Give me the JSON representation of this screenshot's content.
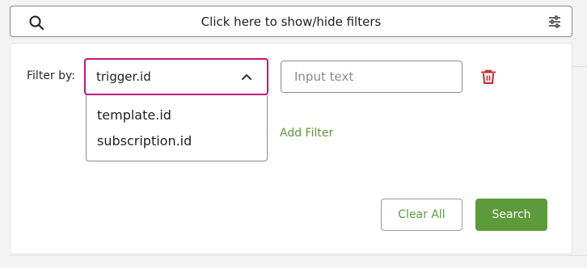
{
  "filter_toggle": {
    "label": "Click here to show/hide filters",
    "left_icon": "search-icon",
    "right_icon": "sliders-icon"
  },
  "filter_row": {
    "label": "Filter by:",
    "field_selected": "trigger.id",
    "field_options": [
      "template.id",
      "subscription.id"
    ],
    "value_placeholder": "Input text",
    "value": "",
    "delete_icon": "trash-icon"
  },
  "add_filter_label": "Add Filter",
  "actions": {
    "clear_label": "Clear All",
    "search_label": "Search"
  },
  "colors": {
    "accent_green": "#5c9a3a",
    "focus_magenta": "#c2127f",
    "delete_red": "#c62828"
  }
}
